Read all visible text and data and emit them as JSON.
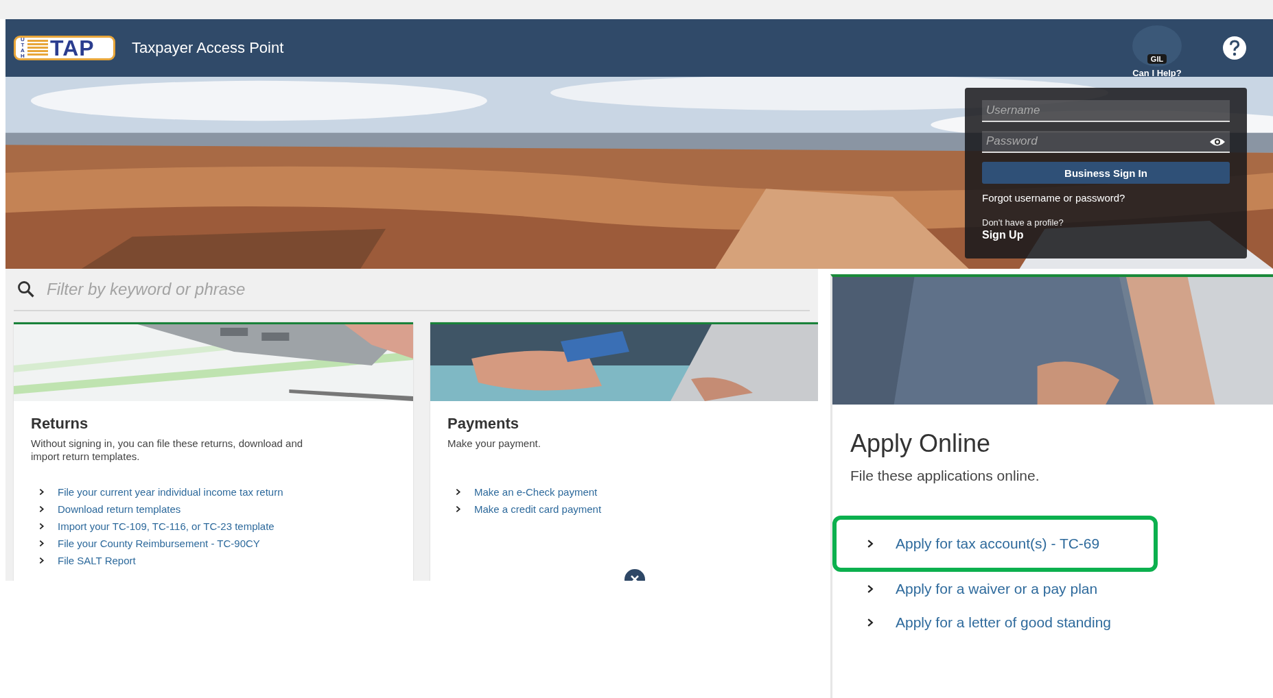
{
  "header": {
    "logo": {
      "state_letters": "UTAH",
      "mark": "TAP"
    },
    "title": "Taxpayer Access Point",
    "assistant": {
      "badge": "GIL",
      "label": "Can I Help?"
    }
  },
  "login": {
    "username_placeholder": "Username",
    "password_placeholder": "Password",
    "sign_in_button": "Business Sign In",
    "forgot_link": "Forgot username or password?",
    "signup_prompt": "Don't have a profile?",
    "signup_link": "Sign Up"
  },
  "search": {
    "placeholder": "Filter by keyword or phrase"
  },
  "cards": [
    {
      "kind": "returns",
      "title": "Returns",
      "description": "Without signing in, you can file these returns, download and import return templates.",
      "links": [
        "File your current year individual income tax return",
        "Download return templates",
        "Import your TC-109, TC-116, or TC-23 template",
        "File your County Reimbursement - TC-90CY",
        "File SALT Report"
      ]
    },
    {
      "kind": "payments",
      "title": "Payments",
      "description": "Make your payment.",
      "links": [
        "Make an e-Check payment",
        "Make a credit card payment"
      ]
    }
  ],
  "apply_card": {
    "title": "Apply Online",
    "description": "File these applications online.",
    "links": [
      {
        "label": "Apply for tax account(s) - TC-69",
        "highlighted": true
      },
      {
        "label": "Apply for a waiver or a pay plan",
        "highlighted": false
      },
      {
        "label": "Apply for a letter of good standing",
        "highlighted": false
      }
    ]
  }
}
